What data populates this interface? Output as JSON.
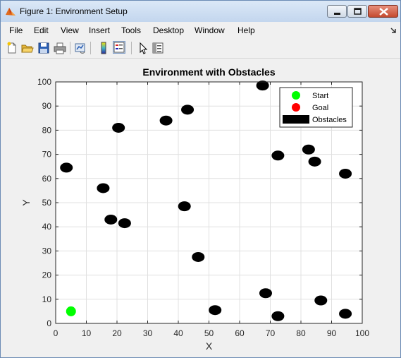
{
  "window": {
    "title": "Figure 1: Environment Setup",
    "icon": "matlab-figure-icon",
    "controls": [
      "minimize-icon",
      "maximize-icon",
      "close-icon"
    ]
  },
  "menu": {
    "items": [
      "File",
      "Edit",
      "View",
      "Insert",
      "Tools",
      "Desktop",
      "Window",
      "Help"
    ]
  },
  "toolbar": {
    "buttons": [
      "new-figure-icon",
      "open-file-icon",
      "save-icon",
      "print-icon",
      "link-plot-icon",
      "insert-colorbar-icon",
      "insert-legend-icon",
      "pointer-icon",
      "property-inspector-icon"
    ]
  },
  "colors": {
    "start": "#00ff00",
    "goal": "#ff0000",
    "obstacle": "#000000",
    "grid": "#e0e0e0",
    "axes_bg": "#ffffff"
  },
  "chart_data": {
    "type": "scatter",
    "title": "Environment with Obstacles",
    "xlabel": "X",
    "ylabel": "Y",
    "xlim": [
      0,
      100
    ],
    "ylim": [
      0,
      100
    ],
    "xticks": [
      0,
      10,
      20,
      30,
      40,
      50,
      60,
      70,
      80,
      90,
      100
    ],
    "yticks": [
      0,
      10,
      20,
      30,
      40,
      50,
      60,
      70,
      80,
      90,
      100
    ],
    "grid": true,
    "legend_position": "top-right",
    "series": [
      {
        "name": "Start",
        "color": "#00ff00",
        "marker": "circle",
        "points": [
          [
            5,
            5
          ]
        ]
      },
      {
        "name": "Goal",
        "color": "#ff0000",
        "marker": "circle",
        "points": []
      },
      {
        "name": "Obstacles",
        "color": "#000000",
        "marker": "ellipse",
        "points": [
          [
            3.5,
            64.5
          ],
          [
            15.5,
            56
          ],
          [
            18,
            43
          ],
          [
            20.5,
            81
          ],
          [
            22.5,
            41.5
          ],
          [
            36,
            84
          ],
          [
            42,
            48.5
          ],
          [
            43,
            88.5
          ],
          [
            46.5,
            27.5
          ],
          [
            52,
            5.5
          ],
          [
            67.5,
            98.5
          ],
          [
            68.5,
            12.5
          ],
          [
            72.5,
            69.5
          ],
          [
            72.5,
            3
          ],
          [
            82.5,
            72
          ],
          [
            84.5,
            67
          ],
          [
            86.5,
            9.5
          ],
          [
            94.5,
            62
          ],
          [
            94.5,
            4
          ]
        ]
      }
    ]
  }
}
